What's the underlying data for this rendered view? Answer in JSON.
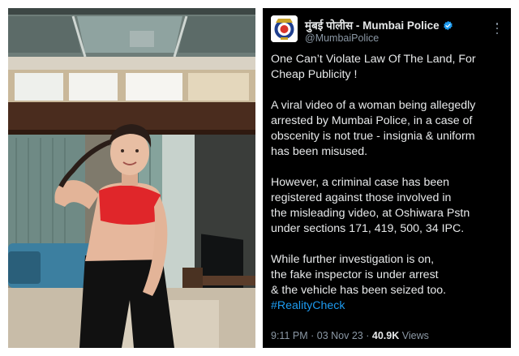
{
  "photo": {
    "description_icon": "woman-photo"
  },
  "tweet": {
    "display_name": "मुंबई पोलीस - Mumbai Police",
    "handle": "@MumbaiPolice",
    "verified_icon": "verified-badge-icon",
    "more_icon": "more-vertical-icon",
    "paragraphs": [
      "One Can’t  Violate Law Of The Land,  For\nCheap Publicity !",
      "A viral video of a woman being allegedly\narrested by Mumbai Police, in a case of\nobscenity is not true - insignia & uniform\nhas been misused.",
      "However, a criminal case has been\nregistered against those involved in\nthe misleading video, at Oshiwara Pstn\nunder sections 171, 419, 500, 34 IPC.",
      "While further investigation is on,\nthe fake inspector is under arrest\n& the vehicle has been seized too."
    ],
    "hashtag": "#RealityCheck",
    "time": "9:11 PM",
    "separator": "·",
    "date": "03 Nov 23",
    "views_count": "40.9K",
    "views_label": "Views",
    "colors": {
      "background": "#000000",
      "text": "#e7e9ea",
      "secondary": "#8b98a5",
      "link": "#1d9bf0",
      "verified": "#1d9bf0"
    }
  }
}
